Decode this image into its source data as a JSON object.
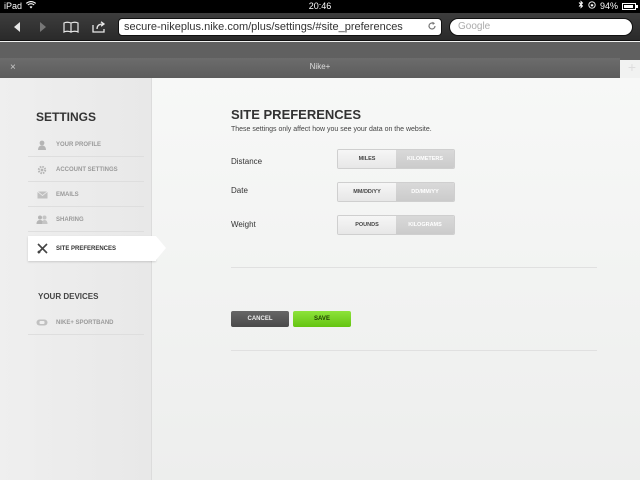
{
  "status": {
    "device": "iPad",
    "time": "20:46",
    "battery": "94%",
    "battery_level": 0.94
  },
  "browser": {
    "url": "secure-nikeplus.nike.com/plus/settings/#site_preferences",
    "search_placeholder": "Google",
    "tab_title": "Nike+",
    "tab_close": "×",
    "tab_add": "+"
  },
  "sidebar": {
    "title": "SETTINGS",
    "items": [
      {
        "label": "YOUR PROFILE",
        "icon": "person-icon"
      },
      {
        "label": "ACCOUNT SETTINGS",
        "icon": "gear-icon"
      },
      {
        "label": "EMAILS",
        "icon": "envelope-icon"
      },
      {
        "label": "SHARING",
        "icon": "people-icon"
      },
      {
        "label": "SITE PREFERENCES",
        "icon": "tools-icon",
        "active": true
      }
    ],
    "devices_title": "YOUR DEVICES",
    "devices": [
      {
        "label": "NIKE+ SPORTBAND",
        "icon": "sportband-icon"
      }
    ]
  },
  "main": {
    "title": "SITE PREFERENCES",
    "subtitle": "These settings only affect how you see your data on the website.",
    "prefs": [
      {
        "label": "Distance",
        "options": [
          "MILES",
          "KILOMETERS"
        ],
        "selected": 0
      },
      {
        "label": "Date",
        "options": [
          "MM/DD/YY",
          "DD/MM/YY"
        ],
        "selected": 0
      },
      {
        "label": "Weight",
        "options": [
          "POUNDS",
          "KILOGRAMS"
        ],
        "selected": 0
      }
    ],
    "cancel_label": "CANCEL",
    "save_label": "SAVE"
  }
}
